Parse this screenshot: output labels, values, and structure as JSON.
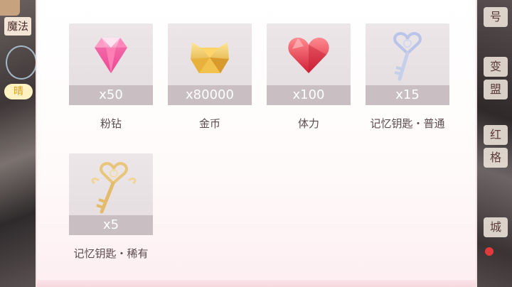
{
  "background": {
    "left_tag": "魔法",
    "left_badge": "晴",
    "right_buttons": [
      "号",
      "变",
      "盟",
      "红",
      "格",
      "城"
    ]
  },
  "rewards": [
    {
      "qty": "x50",
      "name": "粉钻",
      "icon": "pink-diamond-icon"
    },
    {
      "qty": "x80000",
      "name": "金币",
      "icon": "gold-coin-cat-icon"
    },
    {
      "qty": "x100",
      "name": "体力",
      "icon": "red-heart-icon"
    },
    {
      "qty": "x15",
      "name": "记忆钥匙・普通",
      "icon": "silver-key-icon"
    },
    {
      "qty": "x5",
      "name": "记忆钥匙・稀有",
      "icon": "gold-key-icon"
    }
  ],
  "colors": {
    "panel": "#fffafa",
    "tile": "#e8e1e4",
    "qty_bar": "#c9bfc3",
    "label": "#5c4b4e"
  }
}
